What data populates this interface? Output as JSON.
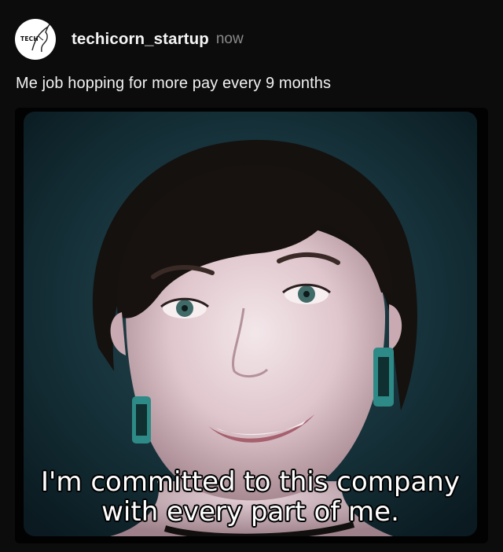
{
  "post": {
    "avatar": {
      "text": "TECH",
      "icon": "unicorn-icon"
    },
    "username": "techicorn_startup",
    "timestamp": "now",
    "caption": "Me job hopping for more pay every 9 months"
  },
  "media": {
    "subtitle_line_1": "I'm committed to this company",
    "subtitle_line_2": "with every part of me."
  },
  "colors": {
    "background": "#0c0c0c",
    "text_primary": "#f5f5f5",
    "text_secondary": "#8a8a8a"
  }
}
